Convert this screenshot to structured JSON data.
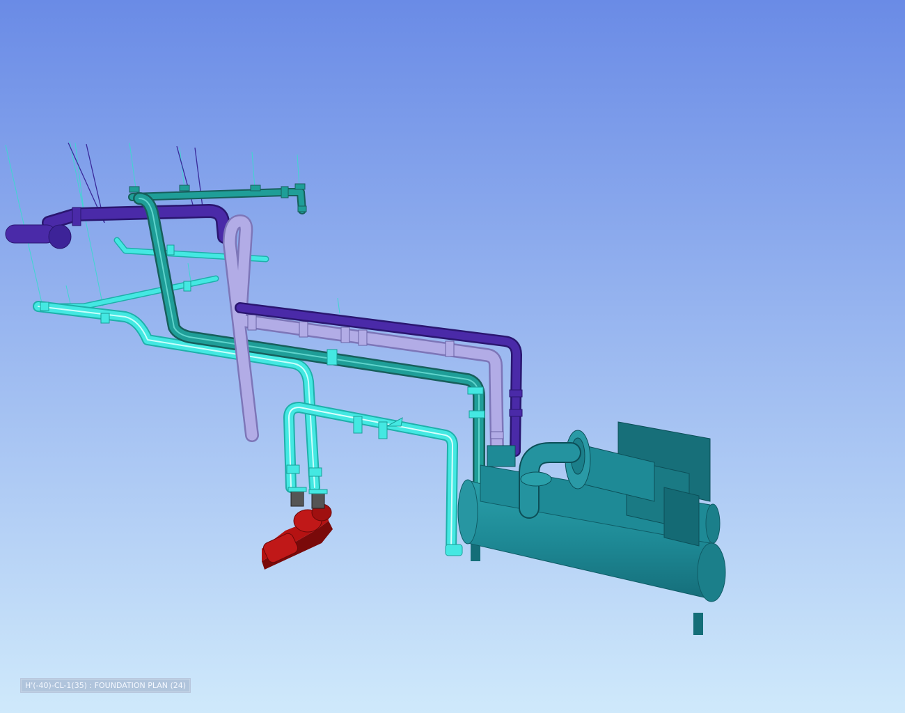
{
  "viewport": {
    "background_top": "#6a8be6",
    "background_bottom": "#cfe9fb"
  },
  "colors": {
    "chilled_water_pipe": "#44e8e2",
    "condenser_water_pipe": "#1f9e98",
    "supply_pipe_lavender": "#b2ace6",
    "return_pipe_indigo": "#4a2aa8",
    "chiller": "#1e8a96",
    "pump": "#b51212"
  },
  "objects": [
    {
      "name": "chiller-unit",
      "icon": "chiller-icon"
    },
    {
      "name": "pump-unit",
      "icon": "pump-icon"
    }
  ],
  "status": {
    "view_label": "H'(-40)-CL-1(35) : FOUNDATION PLAN (24)"
  }
}
